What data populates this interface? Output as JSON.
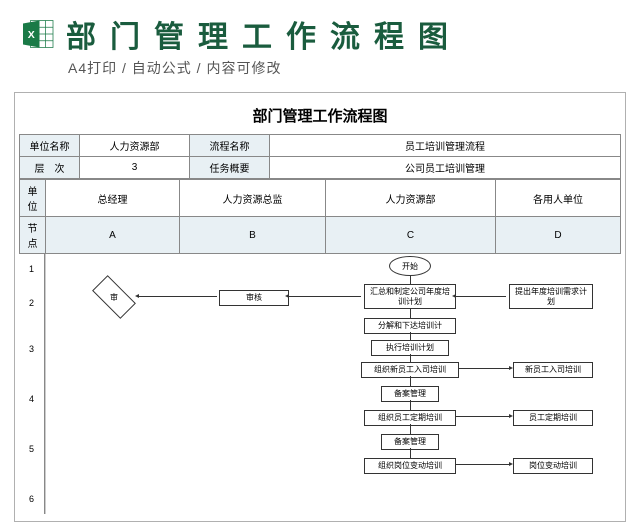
{
  "header": {
    "title": "部门管理工作流程图",
    "subtitle": "A4打印 / 自动公式 / 内容可修改"
  },
  "doc": {
    "title": "部门管理工作流程图",
    "meta": {
      "unit_label": "单位名称",
      "unit_value": "人力资源部",
      "flow_label": "流程名称",
      "flow_value": "员工培训管理流程",
      "level_label": "层　次",
      "level_value": "3",
      "task_label": "任务概要",
      "task_value": "公司员工培训管理"
    },
    "columns": {
      "unit_label": "单位",
      "units": [
        "总经理",
        "人力资源总监",
        "人力资源部",
        "各用人单位"
      ],
      "node_label": "节点",
      "nodes": [
        "A",
        "B",
        "C",
        "D"
      ]
    },
    "rows": [
      "1",
      "2",
      "3",
      "4",
      "5",
      "6"
    ],
    "flow": {
      "start": "开始",
      "shen": "审",
      "shenhe": "审核",
      "c1": "汇总和制定公司年度培训计划",
      "d1": "提出年度培训需求计划",
      "c2": "分解和下达培训计",
      "c3a": "执行培训计划",
      "c3b": "组织新员工入司培训",
      "d3": "新员工入司培训",
      "c4a": "备案管理",
      "c4b": "组织员工定期培训",
      "d4": "员工定期培训",
      "c5a": "备案管理",
      "c5b": "组织岗位变动培训",
      "d5": "岗位变动培训"
    }
  }
}
